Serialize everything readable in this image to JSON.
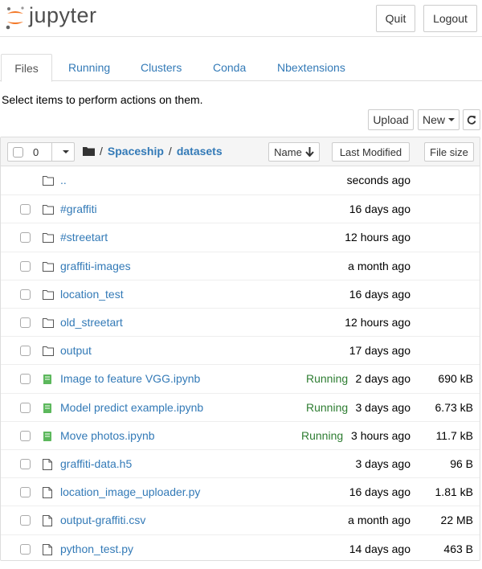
{
  "header": {
    "logo_text": "jupyter",
    "quit_label": "Quit",
    "logout_label": "Logout"
  },
  "tabs": [
    {
      "label": "Files",
      "active": true
    },
    {
      "label": "Running",
      "active": false
    },
    {
      "label": "Clusters",
      "active": false
    },
    {
      "label": "Conda",
      "active": false
    },
    {
      "label": "Nbextensions",
      "active": false
    }
  ],
  "instructions": "Select items to perform actions on them.",
  "toolbar": {
    "upload_label": "Upload",
    "new_label": "New",
    "refresh_icon": "refresh-icon"
  },
  "list_header": {
    "selected_count": "0",
    "breadcrumb": [
      "Spaceship",
      "datasets"
    ],
    "sort_name_label": "Name",
    "sort_modified_label": "Last Modified",
    "sort_size_label": "File size"
  },
  "files": [
    {
      "name": "..",
      "type": "folder",
      "status": "",
      "modified": "seconds ago",
      "size": ""
    },
    {
      "name": "#graffiti",
      "type": "folder",
      "status": "",
      "modified": "16 days ago",
      "size": ""
    },
    {
      "name": "#streetart",
      "type": "folder",
      "status": "",
      "modified": "12 hours ago",
      "size": ""
    },
    {
      "name": "graffiti-images",
      "type": "folder",
      "status": "",
      "modified": "a month ago",
      "size": ""
    },
    {
      "name": "location_test",
      "type": "folder",
      "status": "",
      "modified": "16 days ago",
      "size": ""
    },
    {
      "name": "old_streetart",
      "type": "folder",
      "status": "",
      "modified": "12 hours ago",
      "size": ""
    },
    {
      "name": "output",
      "type": "folder",
      "status": "",
      "modified": "17 days ago",
      "size": ""
    },
    {
      "name": "Image to feature VGG.ipynb",
      "type": "notebook",
      "status": "Running",
      "modified": "2 days ago",
      "size": "690 kB"
    },
    {
      "name": "Model predict example.ipynb",
      "type": "notebook",
      "status": "Running",
      "modified": "3 days ago",
      "size": "6.73 kB"
    },
    {
      "name": "Move photos.ipynb",
      "type": "notebook",
      "status": "Running",
      "modified": "3 hours ago",
      "size": "11.7 kB"
    },
    {
      "name": "graffiti-data.h5",
      "type": "file",
      "status": "",
      "modified": "3 days ago",
      "size": "96 B"
    },
    {
      "name": "location_image_uploader.py",
      "type": "file",
      "status": "",
      "modified": "16 days ago",
      "size": "1.81 kB"
    },
    {
      "name": "output-graffiti.csv",
      "type": "file",
      "status": "",
      "modified": "a month ago",
      "size": "22 MB"
    },
    {
      "name": "python_test.py",
      "type": "file",
      "status": "",
      "modified": "14 days ago",
      "size": "463 B"
    }
  ],
  "colors": {
    "link": "#337ab7",
    "running": "#2e7d32",
    "notebook_icon": "#5cb85c",
    "logo_orange": "#f37726"
  }
}
